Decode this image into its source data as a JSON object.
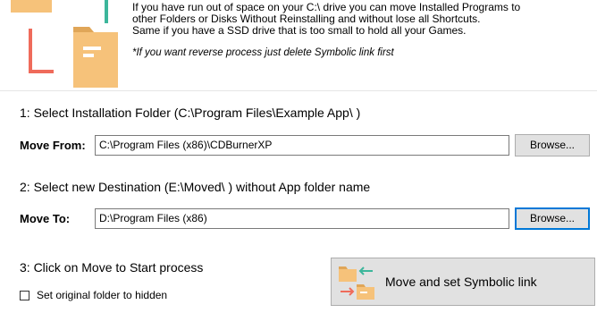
{
  "intro": {
    "line1": "If you have run out of space on your C:\\ drive you can move Installed Programs to",
    "line2": "other Folders or Disks Without Reinstalling and without lose all Shortcuts.",
    "line3": "Same if you have a SSD drive that is too small to hold all your Games.",
    "note": "*If you want reverse process just delete Symbolic link first"
  },
  "step1": {
    "label": "1: Select Installation Folder (C:\\Program Files\\Example App\\ )"
  },
  "move_from": {
    "label": "Move From:",
    "value": "C:\\Program Files (x86)\\CDBurnerXP",
    "browse_label": "Browse..."
  },
  "step2": {
    "label": "2: Select new Destination (E:\\Moved\\ ) without App folder name"
  },
  "move_to": {
    "label": "Move To:",
    "value": "D:\\Program Files (x86)",
    "browse_label": "Browse..."
  },
  "step3": {
    "label": "3: Click on Move to Start process"
  },
  "hidden_checkbox": {
    "label": "Set original folder to hidden",
    "checked": false
  },
  "move_button": {
    "label": "Move and set Symbolic link",
    "icon": "folder-move-icon"
  },
  "colors": {
    "folder": "#f6c27a",
    "folder_dark": "#e0a658",
    "teal": "#3cb69b",
    "red": "#ef6b5b",
    "focus_border": "#0078d7",
    "button_bg": "#e1e1e1"
  }
}
